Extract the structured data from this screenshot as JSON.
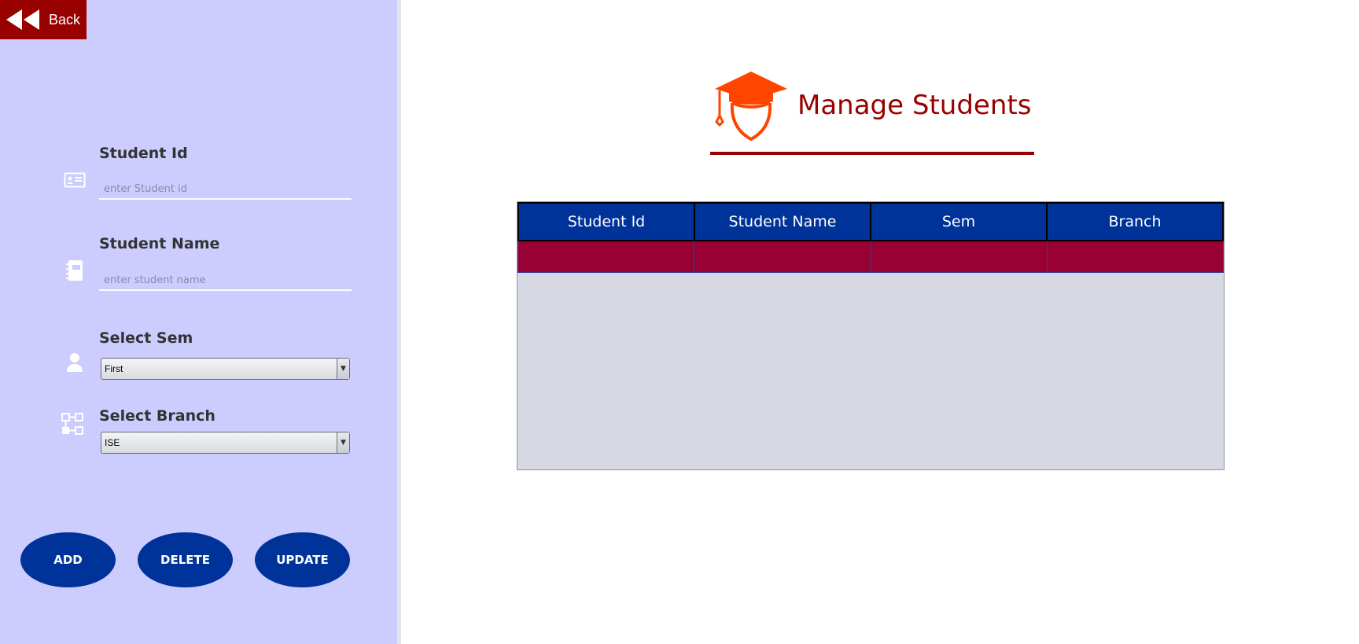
{
  "back": {
    "label": "Back"
  },
  "form": {
    "student_id": {
      "label": "Student Id",
      "placeholder": "enter Student id",
      "value": ""
    },
    "student_name": {
      "label": "Student Name",
      "placeholder": "enter student name",
      "value": ""
    },
    "sem": {
      "label": "Select Sem",
      "selected": "First"
    },
    "branch": {
      "label": "Select Branch",
      "selected": "ISE"
    }
  },
  "buttons": {
    "add": "ADD",
    "delete": "DELETE",
    "update": "UPDATE"
  },
  "header": {
    "title": "Manage Students"
  },
  "table": {
    "columns": [
      "Student Id",
      "Student Name",
      "Sem",
      "Branch"
    ],
    "rows": [
      [
        "",
        "",
        "",
        ""
      ]
    ]
  },
  "colors": {
    "panel_bg": "#ccccff",
    "accent_red": "#990000",
    "primary_blue": "#003399",
    "row_highlight": "#990033",
    "icon_orange": "#ff4500"
  }
}
